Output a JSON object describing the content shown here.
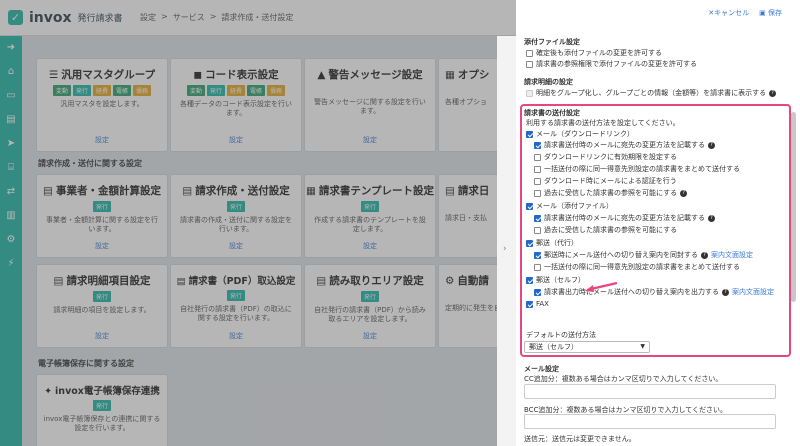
{
  "header": {
    "logo_text": "invox",
    "logo_sub": "発行請求書",
    "breadcrumb": [
      "設定",
      ">",
      "サービス",
      ">",
      "請求作成・送付設定"
    ]
  },
  "sidebar_icons": [
    "arrow-circle-icon",
    "home-icon",
    "inbox-icon",
    "document-icon",
    "send-icon",
    "bank-icon",
    "transfer-icon",
    "chart-icon",
    "gear-icon",
    "bolt-icon"
  ],
  "cards_row1": [
    {
      "icon": "☰",
      "title": "汎用マスタグループ",
      "tags": [
        "変動",
        "発行",
        "経費",
        "電帳",
        "債務"
      ],
      "desc": "汎用マスタを設定します。",
      "link": "設定"
    },
    {
      "icon": "◼",
      "title": "コード表示設定",
      "tags": [
        "変動",
        "発行",
        "経費",
        "電帳",
        "債務"
      ],
      "desc": "各種データのコード表示設定を行います。",
      "link": "設定"
    },
    {
      "icon": "▲",
      "title": "警告メッセージ設定",
      "tags": [],
      "desc": "警告メッセージに関する設定を行います。",
      "link": "設定"
    },
    {
      "icon": "▦",
      "title": "オプシ",
      "tags": [],
      "desc": "各種オプショ",
      "link": ""
    }
  ],
  "section1": "請求作成・送付に関する設定",
  "cards_row2": [
    {
      "icon": "▤",
      "title": "事業者・金額計算設定",
      "tag": "発行",
      "desc": "事業者・金額計算に関する設定を行います。",
      "link": "設定"
    },
    {
      "icon": "▤",
      "title": "請求作成・送付設定",
      "tag": "発行",
      "desc": "請求書の作成・送付に関する設定を行います。",
      "link": "設定"
    },
    {
      "icon": "▦",
      "title": "請求書テンプレート設定",
      "tag": "発行",
      "desc": "作成する請求書のテンプレートを設定します。",
      "link": "設定"
    },
    {
      "icon": "▤",
      "title": "請求日",
      "tag": "",
      "desc": "請求日・支払",
      "link": ""
    }
  ],
  "cards_row3": [
    {
      "icon": "▤",
      "title": "請求明細項目設定",
      "tag": "発行",
      "desc": "請求明細の項目を設定します。",
      "link": "設定"
    },
    {
      "icon": "▤",
      "title": "請求書（PDF）取込設定",
      "tag": "発行",
      "desc": "自社発行の請求書（PDF）の取込に関する設定を行います。",
      "link": "設定"
    },
    {
      "icon": "▤",
      "title": "読み取りエリア設定",
      "tag": "発行",
      "desc": "自社発行の請求書（PDF）から読み取るエリアを設定します。",
      "link": "設定"
    },
    {
      "icon": "⚙",
      "title": "自動請",
      "tag": "",
      "desc": "定期的に発生を自動で作成",
      "link": ""
    }
  ],
  "section2": "電子帳簿保存に関する設定",
  "card_row4": {
    "icon": "✦",
    "title": "invox電子帳簿保存連携",
    "tag": "発行",
    "desc": "invox電子帳簿保存との連携に関する設定を行います。",
    "link": "設定"
  },
  "panel": {
    "cancel": "✕キャンセル",
    "save": "保存",
    "attach_head": "添付ファイル設定",
    "attach_opts": [
      "確定後も添付ファイルの変更を許可する",
      "請求書の参照権限で添付ファイルの変更を許可する"
    ],
    "detail_head": "請求明細の設定",
    "detail_opt": "明細をグループ化し、グループごとの情報（金額等）を請求書に表示する",
    "send_head": "請求書の送付設定",
    "send_desc": "利用する請求書の送付方法を設定してください。",
    "mail_dl": "メール（ダウンロードリンク）",
    "mail_dl_opts": [
      "請求書送付時のメールに宛先の変更方法を記載する",
      "ダウンロードリンクに有効期限を設定する",
      "一括送付の際に同一得意先別設定の請求書をまとめて送付する",
      "ダウンロード時にメールによる認証を行う",
      "過去に受信した請求書の参照を可能にする"
    ],
    "mail_att": "メール（添付ファイル）",
    "mail_att_opts": [
      "請求書送付時のメールに宛先の変更方法を記載する",
      "過去に受信した請求書の参照を可能にする"
    ],
    "post_agent": "郵送（代行）",
    "post_agent_opts": [
      "郵送時にメール送付への切り替え案内を同封する",
      "一括送付の際に同一得意先別設定の請求書をまとめて送付する"
    ],
    "guide_link": "案内文面設定",
    "post_self": "郵送（セルフ）",
    "post_self_opt": "請求書出力時にメール送付への切り替え案内を出力する",
    "fax": "FAX",
    "default_label": "デフォルトの送付方法",
    "default_value": "郵送（セルフ）",
    "mail_head": "メール設定",
    "cc_label": "CC追加分：複数ある場合はカンマ区切りで入力してください。",
    "bcc_label": "BCC追加分：複数ある場合はカンマ区切りで入力してください。",
    "sender_label": "送信元：送信元は変更できません。"
  }
}
